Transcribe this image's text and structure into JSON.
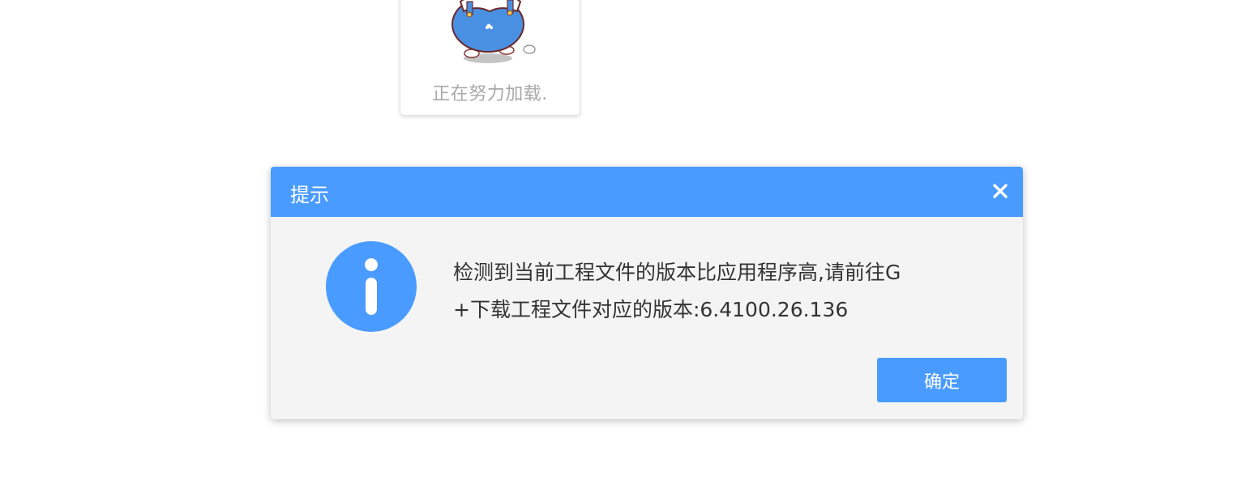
{
  "loading": {
    "text": "正在努力加载.",
    "mascot": "cartoon-mascot-image"
  },
  "dialog": {
    "title": "提示",
    "close_icon": "close-icon",
    "info_icon": "info-icon",
    "message_line1": "检测到当前工程文件的版本比应用程序高,请前往G",
    "message_line2": "+下载工程文件对应的版本:6.4100.26.136",
    "ok_label": "确定"
  },
  "colors": {
    "accent": "#4a9bff",
    "dialog_background": "#f4f4f4",
    "message_text": "#333333",
    "loading_text": "#a9a9a9"
  }
}
